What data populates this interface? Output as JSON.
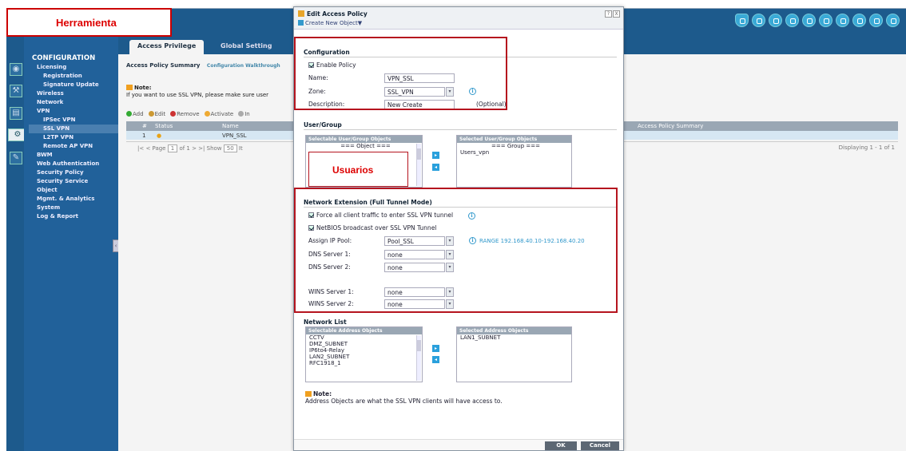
{
  "annotations": {
    "tool_label": "Herramienta",
    "users_label": "Usuarios"
  },
  "top_icons": [
    "shield-icon",
    "circle-icon",
    "circle-icon",
    "circle-icon",
    "circle-icon",
    "circle-icon",
    "circle-icon",
    "circle-icon",
    "info-icon",
    "circle-icon"
  ],
  "nav": {
    "title": "CONFIGURATION",
    "items": [
      "Licensing",
      "Registration",
      "Signature Update",
      "Wireless",
      "Network",
      "VPN",
      "IPSec VPN",
      "SSL VPN",
      "L2TP VPN",
      "Remote AP VPN",
      "BWM",
      "Web Authentication",
      "Security Policy",
      "Security Service",
      "Object",
      "Mgmt. & Analytics",
      "System",
      "Log & Report"
    ]
  },
  "main": {
    "tabs": [
      "Access Privilege",
      "Global Setting"
    ],
    "summary_title": "Access Policy Summary",
    "walkthrough": "Configuration Walkthrough",
    "note_title": "Note:",
    "note_text": "If you want to use SSL VPN, please make sure user",
    "toolbar": [
      "Add",
      "Edit",
      "Remove",
      "Activate",
      "In"
    ],
    "grid_cols": [
      "#",
      "Status",
      "Name",
      "Access Policy Summary"
    ],
    "row": {
      "num": "1",
      "name": "VPN_SSL"
    },
    "pager_left": "|<  <  Page",
    "page_value": "1",
    "of_pages": "of 1  >  >|  Show",
    "show_value": "50",
    "pager_n": "It",
    "displaying": "Displaying 1 - 1 of 1"
  },
  "dialog": {
    "title": "Edit Access Policy",
    "subtitle": "Create New Object",
    "controls": [
      "?",
      "X"
    ],
    "config_section": "Configuration",
    "enable_policy": "Enable Policy",
    "name_label": "Name:",
    "name_value": "VPN_SSL",
    "zone_label": "Zone:",
    "zone_value": "SSL_VPN",
    "desc_label": "Description:",
    "desc_value": "New Create",
    "optional": "(Optional)",
    "usergroup_section": "User/Group",
    "selectable_users_header": "Selectable User/Group Objects",
    "selectable_users_item": "=== Object ===",
    "selected_users_header": "Selected User/Group Objects",
    "selected_users_group": "=== Group ===",
    "selected_users_item": "Users_vpn",
    "netext_section": "Network Extension (Full Tunnel Mode)",
    "force_all": "Force all client traffic to enter SSL VPN tunnel",
    "netbios": "NetBIOS broadcast over SSL VPN Tunnel",
    "pool_label": "Assign IP Pool:",
    "pool_value": "Pool_SSL",
    "range": "RANGE 192.168.40.10-192.168.40.20",
    "dns1_label": "DNS Server 1:",
    "dns1_value": "none",
    "dns2_label": "DNS Server 2:",
    "dns2_value": "none",
    "wins1_label": "WINS Server 1:",
    "wins1_value": "none",
    "wins2_label": "WINS Server 2:",
    "wins2_value": "none",
    "netlist_section": "Network List",
    "selectable_addr_header": "Selectable Address Objects",
    "selectable_addr_items": [
      "CCTV",
      "DMZ_SUBNET",
      "IP6to4-Relay",
      "LAN2_SUBNET",
      "RFC1918_1"
    ],
    "selected_addr_header": "Selected Address Objects",
    "selected_addr_items": [
      "LAN1_SUBNET"
    ],
    "note_title": "Note:",
    "note_text": "Address Objects are what the SSL VPN clients will have access to.",
    "ok": "OK",
    "cancel": "Cancel"
  }
}
